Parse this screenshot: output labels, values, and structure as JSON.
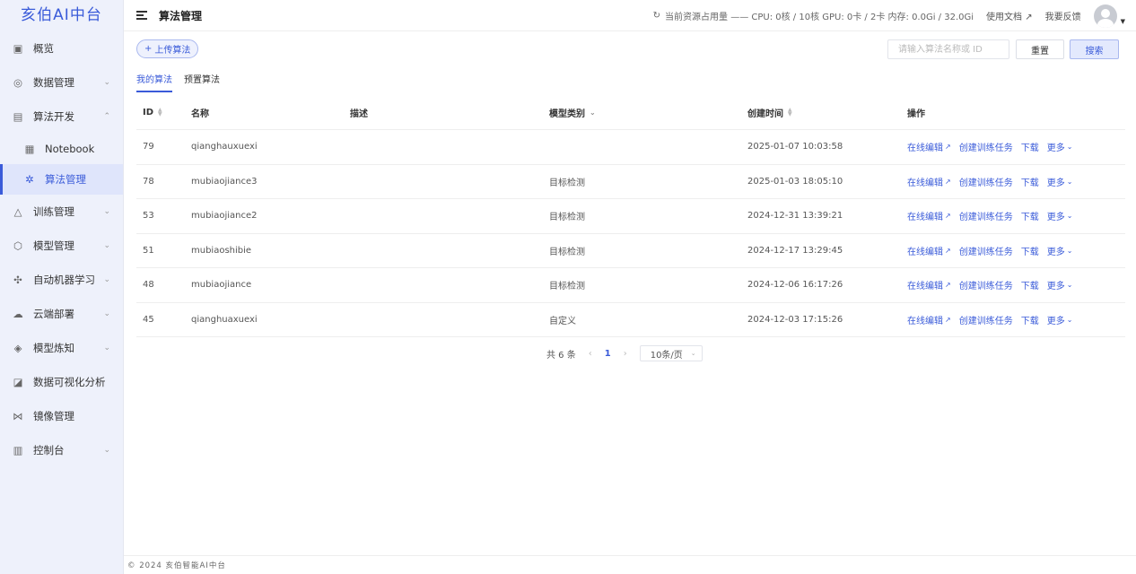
{
  "app": {
    "logo": "亥伯AI中台"
  },
  "sidebar": {
    "items": [
      {
        "label": "概览",
        "icon": "dashboard-icon",
        "chevron": ""
      },
      {
        "label": "数据管理",
        "icon": "data-icon",
        "chevron": "⌄"
      },
      {
        "label": "算法开发",
        "icon": "code-icon",
        "chevron": "⌃"
      },
      {
        "label": "Notebook",
        "icon": "notebook-icon",
        "chevron": ""
      },
      {
        "label": "算法管理",
        "icon": "algorithm-icon",
        "chevron": ""
      },
      {
        "label": "训练管理",
        "icon": "training-icon",
        "chevron": "⌄"
      },
      {
        "label": "模型管理",
        "icon": "model-icon",
        "chevron": "⌄"
      },
      {
        "label": "自动机器学习",
        "icon": "automl-icon",
        "chevron": "⌄"
      },
      {
        "label": "云端部署",
        "icon": "cloud-icon",
        "chevron": "⌄"
      },
      {
        "label": "模型炼知",
        "icon": "distill-icon",
        "chevron": "⌄"
      },
      {
        "label": "数据可视化分析",
        "icon": "chart-icon",
        "chevron": ""
      },
      {
        "label": "镜像管理",
        "icon": "image-icon",
        "chevron": ""
      },
      {
        "label": "控制台",
        "icon": "console-icon",
        "chevron": "⌄"
      }
    ]
  },
  "header": {
    "title": "算法管理",
    "resource": "当前资源占用量 —— CPU: 0核 / 10核 GPU: 0卡 / 2卡 内存: 0.0Gi / 32.0Gi",
    "docs": "使用文档",
    "feedback": "我要反馈"
  },
  "toolbar": {
    "upload_label": "上传算法",
    "search_placeholder": "请输入算法名称或 ID",
    "reset_label": "重置",
    "search_label": "搜索"
  },
  "tabs": [
    {
      "label": "我的算法"
    },
    {
      "label": "预置算法"
    }
  ],
  "table": {
    "columns": {
      "id": "ID",
      "name": "名称",
      "desc": "描述",
      "type": "模型类别",
      "time": "创建时间",
      "ops": "操作"
    },
    "actions": {
      "edit": "在线编辑",
      "train": "创建训练任务",
      "download": "下载",
      "more": "更多"
    },
    "rows": [
      {
        "id": "79",
        "name": "qianghauxuexi",
        "desc": "",
        "type": "",
        "time": "2025-01-07 10:03:58"
      },
      {
        "id": "78",
        "name": "mubiaojiance3",
        "desc": "",
        "type": "目标检测",
        "time": "2025-01-03 18:05:10"
      },
      {
        "id": "53",
        "name": "mubiaojiance2",
        "desc": "",
        "type": "目标检测",
        "time": "2024-12-31 13:39:21"
      },
      {
        "id": "51",
        "name": "mubiaoshibie",
        "desc": "",
        "type": "目标检测",
        "time": "2024-12-17 13:29:45"
      },
      {
        "id": "48",
        "name": "mubiaojiance",
        "desc": "",
        "type": "目标检测",
        "time": "2024-12-06 16:17:26"
      },
      {
        "id": "45",
        "name": "qianghuaxuexi",
        "desc": "",
        "type": "自定义",
        "time": "2024-12-03 17:15:26"
      }
    ]
  },
  "pagination": {
    "total": "共 6 条",
    "current": "1",
    "page_size": "10条/页"
  },
  "footer": {
    "text": "© 2024 亥伯智能AI中台"
  }
}
